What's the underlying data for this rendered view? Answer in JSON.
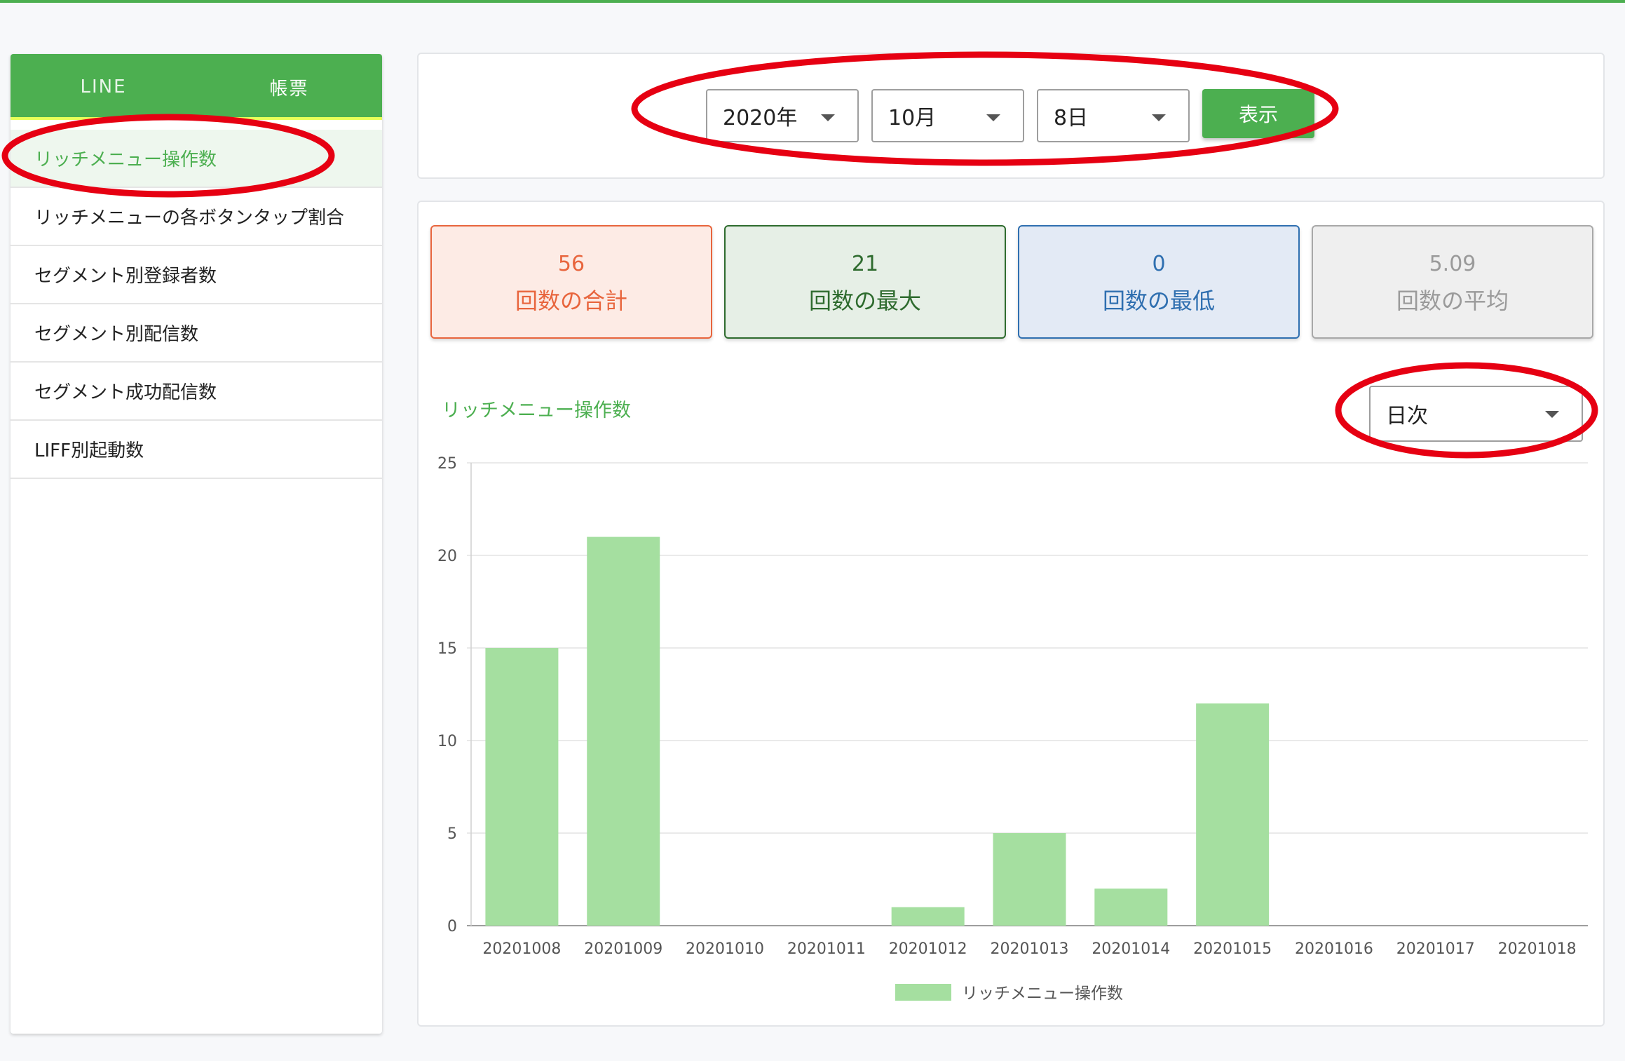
{
  "colors": {
    "brand_green": "#4caf50",
    "bar_green": "#a5dfa0",
    "annotation_red": "#e60012"
  },
  "sidebar": {
    "tabs": [
      {
        "label": "LINE"
      },
      {
        "label": "帳票"
      }
    ],
    "items": [
      {
        "label": "リッチメニュー操作数",
        "active": true
      },
      {
        "label": "リッチメニューの各ボタンタップ割合"
      },
      {
        "label": "セグメント別登録者数"
      },
      {
        "label": "セグメント別配信数"
      },
      {
        "label": "セグメント成功配信数"
      },
      {
        "label": "LIFF別起動数"
      }
    ]
  },
  "filters": {
    "year": "2020年",
    "month": "10月",
    "day": "8日",
    "show_label": "表示"
  },
  "stats": {
    "total": {
      "value": "56",
      "label": "回数の合計"
    },
    "max": {
      "value": "21",
      "label": "回数の最大"
    },
    "min": {
      "value": "0",
      "label": "回数の最低"
    },
    "avg": {
      "value": "5.09",
      "label": "回数の平均"
    }
  },
  "chart_header": {
    "title": "リッチメニュー操作数",
    "period": "日次"
  },
  "chart_data": {
    "type": "bar",
    "categories": [
      "20201008",
      "20201009",
      "20201010",
      "20201011",
      "20201012",
      "20201013",
      "20201014",
      "20201015",
      "20201016",
      "20201017",
      "20201018"
    ],
    "series": [
      {
        "name": "リッチメニュー操作数",
        "values": [
          15,
          21,
          0,
          0,
          1,
          5,
          2,
          12,
          0,
          0,
          0
        ]
      }
    ],
    "ylim": [
      0,
      25
    ],
    "yticks": [
      0,
      5,
      10,
      15,
      20,
      25
    ],
    "grid": true,
    "legend": "bottom"
  }
}
